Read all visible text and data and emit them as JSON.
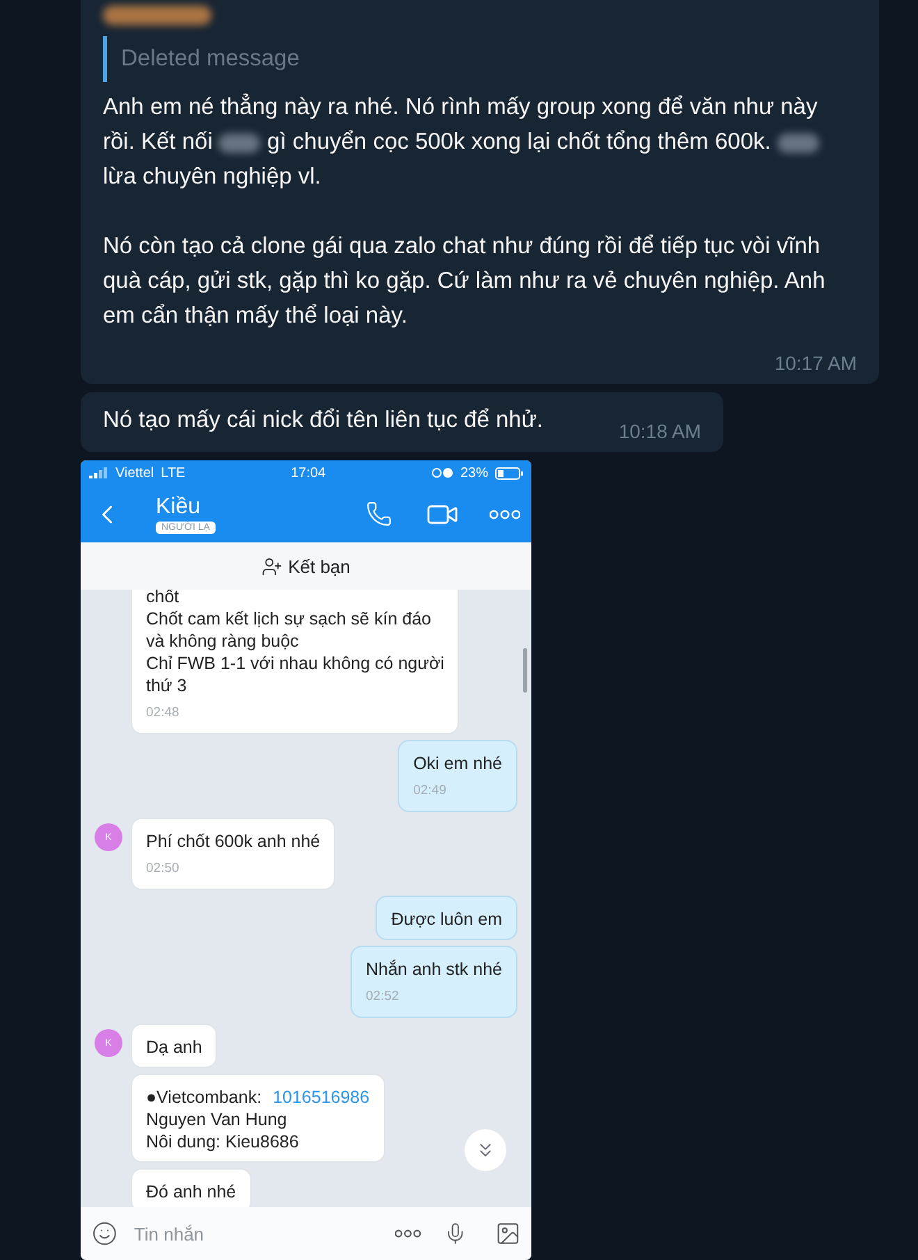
{
  "messages": [
    {
      "kind": "reply",
      "sender": {
        "kind": "redacted"
      },
      "reply": "Deleted message",
      "paragraphs": [
        [
          {
            "kind": "text",
            "text": "Anh em né thẳng này ra nhé. Nó rình mấy group xong để văn như này rồi. Kết nối "
          },
          {
            "kind": "redacted"
          },
          {
            "kind": "text",
            "text": " gì chuyển cọc 500k xong lại chốt tổng thêm 600k. "
          },
          {
            "kind": "redacted"
          },
          {
            "kind": "text",
            "text": " lừa chuyên nghiệp vl."
          }
        ],
        [
          {
            "kind": "text",
            "text": "Nó còn tạo cả clone gái qua zalo chat như đúng rồi để tiếp tục vòi vĩnh quà cáp, gửi stk, gặp thì ko gặp. Cứ làm như ra vẻ chuyên nghiệp.  Anh em cẩn thận mấy thể loại này."
          }
        ]
      ],
      "time": "10:17 AM"
    },
    {
      "kind": "plain",
      "paragraphs": [
        [
          {
            "kind": "text",
            "text": "Nó tạo mấy cái nick đổi tên liên tục để nhử."
          }
        ]
      ],
      "time": "10:18 AM"
    }
  ],
  "phone": {
    "status": {
      "carrier": "Viettel",
      "network": "LTE",
      "clock": "17:04",
      "battery": "23%"
    },
    "contact": {
      "name": "Kiều",
      "badge": "NGƯỜI LẠ"
    },
    "add_friend": "Kết bạn",
    "chat": [
      {
        "kind": "incoming",
        "avatar": false,
        "lines": [
          {
            "text": "chốt"
          },
          {
            "text": "Chốt cam kết lịch sự sạch sẽ kín đáo"
          },
          {
            "text": "và không ràng buộc"
          },
          {
            "text": "Chỉ FWB 1-1 với nhau không có người"
          },
          {
            "text": "thứ 3"
          }
        ],
        "time": "02:48"
      },
      {
        "kind": "outgoing",
        "avatar": false,
        "lines": [
          {
            "text": "Oki em nhé"
          }
        ],
        "time": "02:49"
      },
      {
        "kind": "incoming",
        "avatar": true,
        "avatar_letter": "K",
        "lines": [
          {
            "text": "Phí chốt 600k anh nhé"
          }
        ],
        "time": "02:50"
      },
      {
        "kind": "outgoing",
        "avatar": false,
        "lines": [
          {
            "text": "Được luôn em"
          }
        ]
      },
      {
        "kind": "outgoing",
        "avatar": false,
        "lines": [
          {
            "text": "Nhắn anh stk nhé"
          }
        ],
        "time": "02:52"
      },
      {
        "kind": "incoming",
        "avatar": true,
        "avatar_letter": "K",
        "lines": [
          {
            "text": "Dạ anh"
          }
        ]
      },
      {
        "kind": "incoming",
        "avatar": false,
        "lines": [
          {
            "text": "●Vietcombank:",
            "link": "1016516986"
          },
          {
            "text": "Nguyen Van Hung"
          },
          {
            "text": "Nôi dung: Kieu8686"
          }
        ]
      },
      {
        "kind": "incoming",
        "avatar": false,
        "lines": [
          {
            "text": "Đó anh nhé"
          }
        ]
      }
    ],
    "input_placeholder": "Tin nhắn"
  }
}
